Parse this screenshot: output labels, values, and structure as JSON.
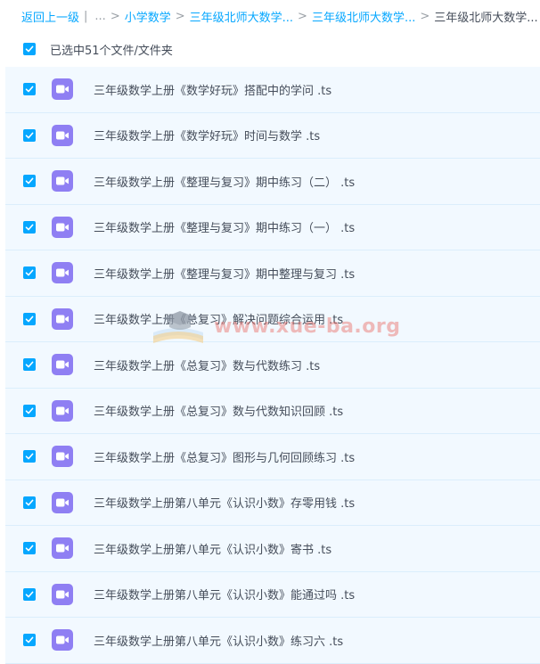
{
  "breadcrumb": {
    "back_label": "返回上一级",
    "separator": "|",
    "ellipsis": "...",
    "crumbs": [
      "小学数学",
      "三年级北师大数学...",
      "三年级北师大数学...",
      "三年级北师大数学..."
    ]
  },
  "selection": {
    "label": "已选中51个文件/文件夹",
    "checked": true
  },
  "files": [
    {
      "name": "三年级数学上册《数学好玩》搭配中的学问 .ts",
      "checked": true,
      "icon": "video-icon"
    },
    {
      "name": "三年级数学上册《数学好玩》时间与数学 .ts",
      "checked": true,
      "icon": "video-icon"
    },
    {
      "name": "三年级数学上册《整理与复习》期中练习（二） .ts",
      "checked": true,
      "icon": "video-icon"
    },
    {
      "name": "三年级数学上册《整理与复习》期中练习（一） .ts",
      "checked": true,
      "icon": "video-icon"
    },
    {
      "name": "三年级数学上册《整理与复习》期中整理与复习 .ts",
      "checked": true,
      "icon": "video-icon"
    },
    {
      "name": "三年级数学上册《总复习》解决问题综合运用 .ts",
      "checked": true,
      "icon": "video-icon"
    },
    {
      "name": "三年级数学上册《总复习》数与代数练习 .ts",
      "checked": true,
      "icon": "video-icon"
    },
    {
      "name": "三年级数学上册《总复习》数与代数知识回顾 .ts",
      "checked": true,
      "icon": "video-icon"
    },
    {
      "name": "三年级数学上册《总复习》图形与几何回顾练习 .ts",
      "checked": true,
      "icon": "video-icon"
    },
    {
      "name": "三年级数学上册第八单元《认识小数》存零用钱 .ts",
      "checked": true,
      "icon": "video-icon"
    },
    {
      "name": "三年级数学上册第八单元《认识小数》寄书 .ts",
      "checked": true,
      "icon": "video-icon"
    },
    {
      "name": "三年级数学上册第八单元《认识小数》能通过吗 .ts",
      "checked": true,
      "icon": "video-icon"
    },
    {
      "name": "三年级数学上册第八单元《认识小数》练习六 .ts",
      "checked": true,
      "icon": "video-icon"
    }
  ],
  "watermark": {
    "text": "www.xue-ba.org",
    "color": "#e96a64"
  },
  "colors": {
    "accent": "#06a7ff",
    "row_bg": "#f2f9ff",
    "video_icon": "#8f7ff3",
    "text": "#454d5a"
  }
}
